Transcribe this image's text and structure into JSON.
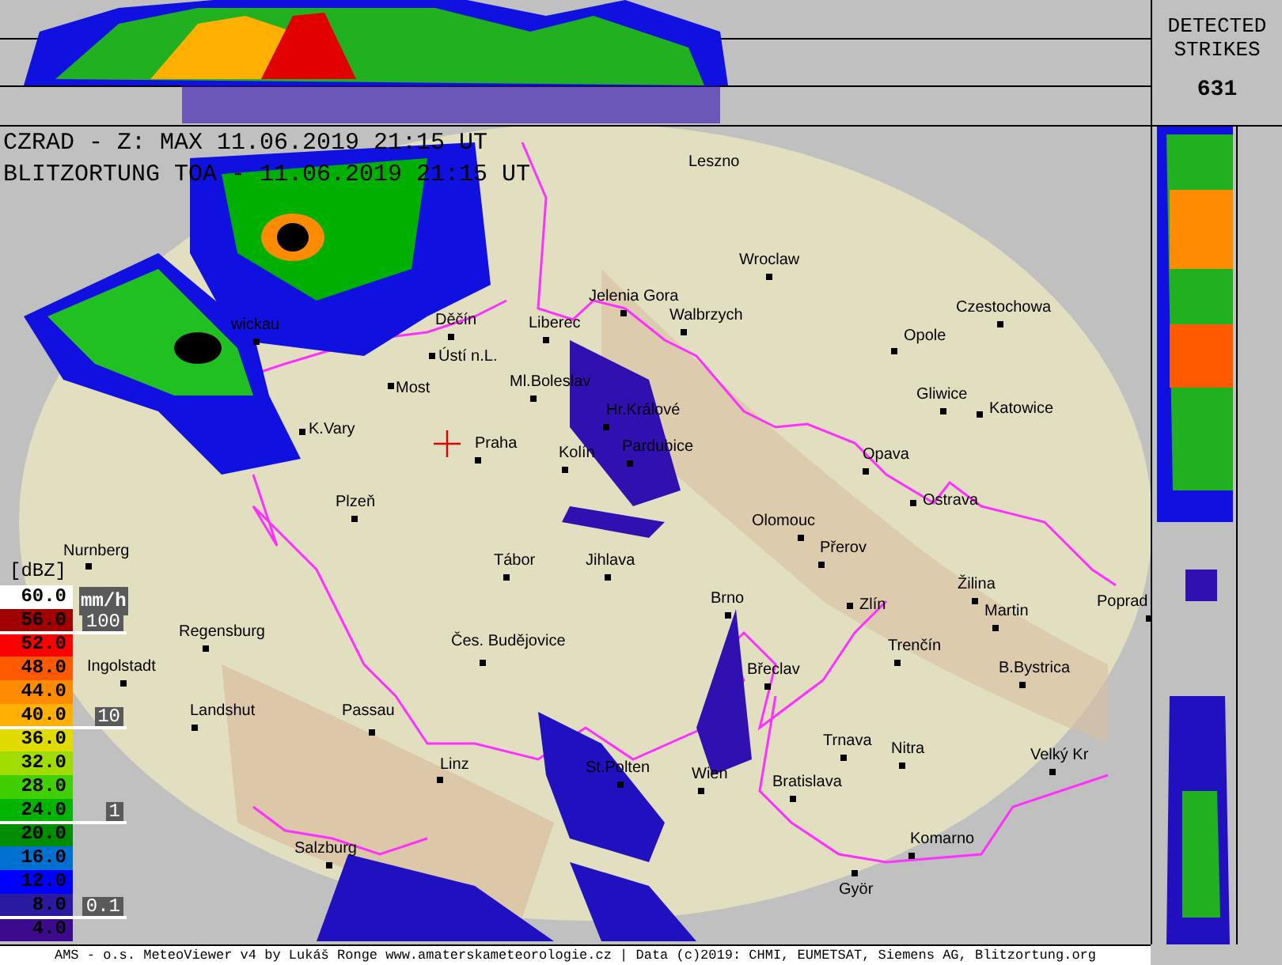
{
  "header": {
    "radar_line": "CZRAD - Z: MAX  11.06.2019 21:15 UT",
    "lightning_line": "BLITZORTUNG TOA - 11.06.2019 21:15 UT"
  },
  "strikes": {
    "label": "DETECTED STRIKES",
    "count": "631"
  },
  "legend": {
    "unit": "[dBZ]",
    "rain_unit": "mm/h",
    "items": [
      {
        "label": "60.0",
        "color": "#ffffff"
      },
      {
        "label": "56.0",
        "color": "#a00000"
      },
      {
        "label": "52.0",
        "color": "#ff0000"
      },
      {
        "label": "48.0",
        "color": "#ff5a00"
      },
      {
        "label": "44.0",
        "color": "#ff8c00"
      },
      {
        "label": "40.0",
        "color": "#ffb000"
      },
      {
        "label": "36.0",
        "color": "#e0dc00"
      },
      {
        "label": "32.0",
        "color": "#a0dc00"
      },
      {
        "label": "28.0",
        "color": "#40d000"
      },
      {
        "label": "24.0",
        "color": "#00b400"
      },
      {
        "label": "20.0",
        "color": "#008c00"
      },
      {
        "label": "16.0",
        "color": "#0070d0"
      },
      {
        "label": "12.0",
        "color": "#0000ff"
      },
      {
        "label": "8.0",
        "color": "#2a1aa0"
      },
      {
        "label": "4.0",
        "color": "#3c0a8c"
      }
    ],
    "rain_ticks": [
      "100",
      "10",
      "1",
      "0.1"
    ]
  },
  "cities": [
    "Leszno",
    "Wroclaw",
    "Jelenia Gora",
    "Czestochowa",
    "wickau",
    "Děčín",
    "Liberec",
    "Walbrzych",
    "Opole",
    "Ústí n.L.",
    "Most",
    "Ml.Boleslav",
    "Gliwice",
    "Katowice",
    "K.Vary",
    "Hr.Králové",
    "Praha",
    "Kolín",
    "Pardubice",
    "Opava",
    "Plzeň",
    "Ostrava",
    "Olomouc",
    "Nurnberg",
    "Přerov",
    "Tábor",
    "Jihlava",
    "Žilina",
    "Brno",
    "Zlín",
    "Poprad",
    "Martin",
    "Regensburg",
    "Čes. Budějovice",
    "Trenčín",
    "Ingolstadt",
    "Břeclav",
    "B.Bystrica",
    "Landshut",
    "Passau",
    "Trnava",
    "Nitra",
    "Linz",
    "St.Polten",
    "Wien",
    "Bratislava",
    "Velký Kr",
    "Salzburg",
    "Komarno",
    "Györ"
  ],
  "footer": "AMS - o.s. MeteoViewer v4 by Lukáš Ronge www.amaterskameteorologie.cz | Data (c)2019: CHMI, EUMETSAT, Siemens AG, Blitzortung.org"
}
